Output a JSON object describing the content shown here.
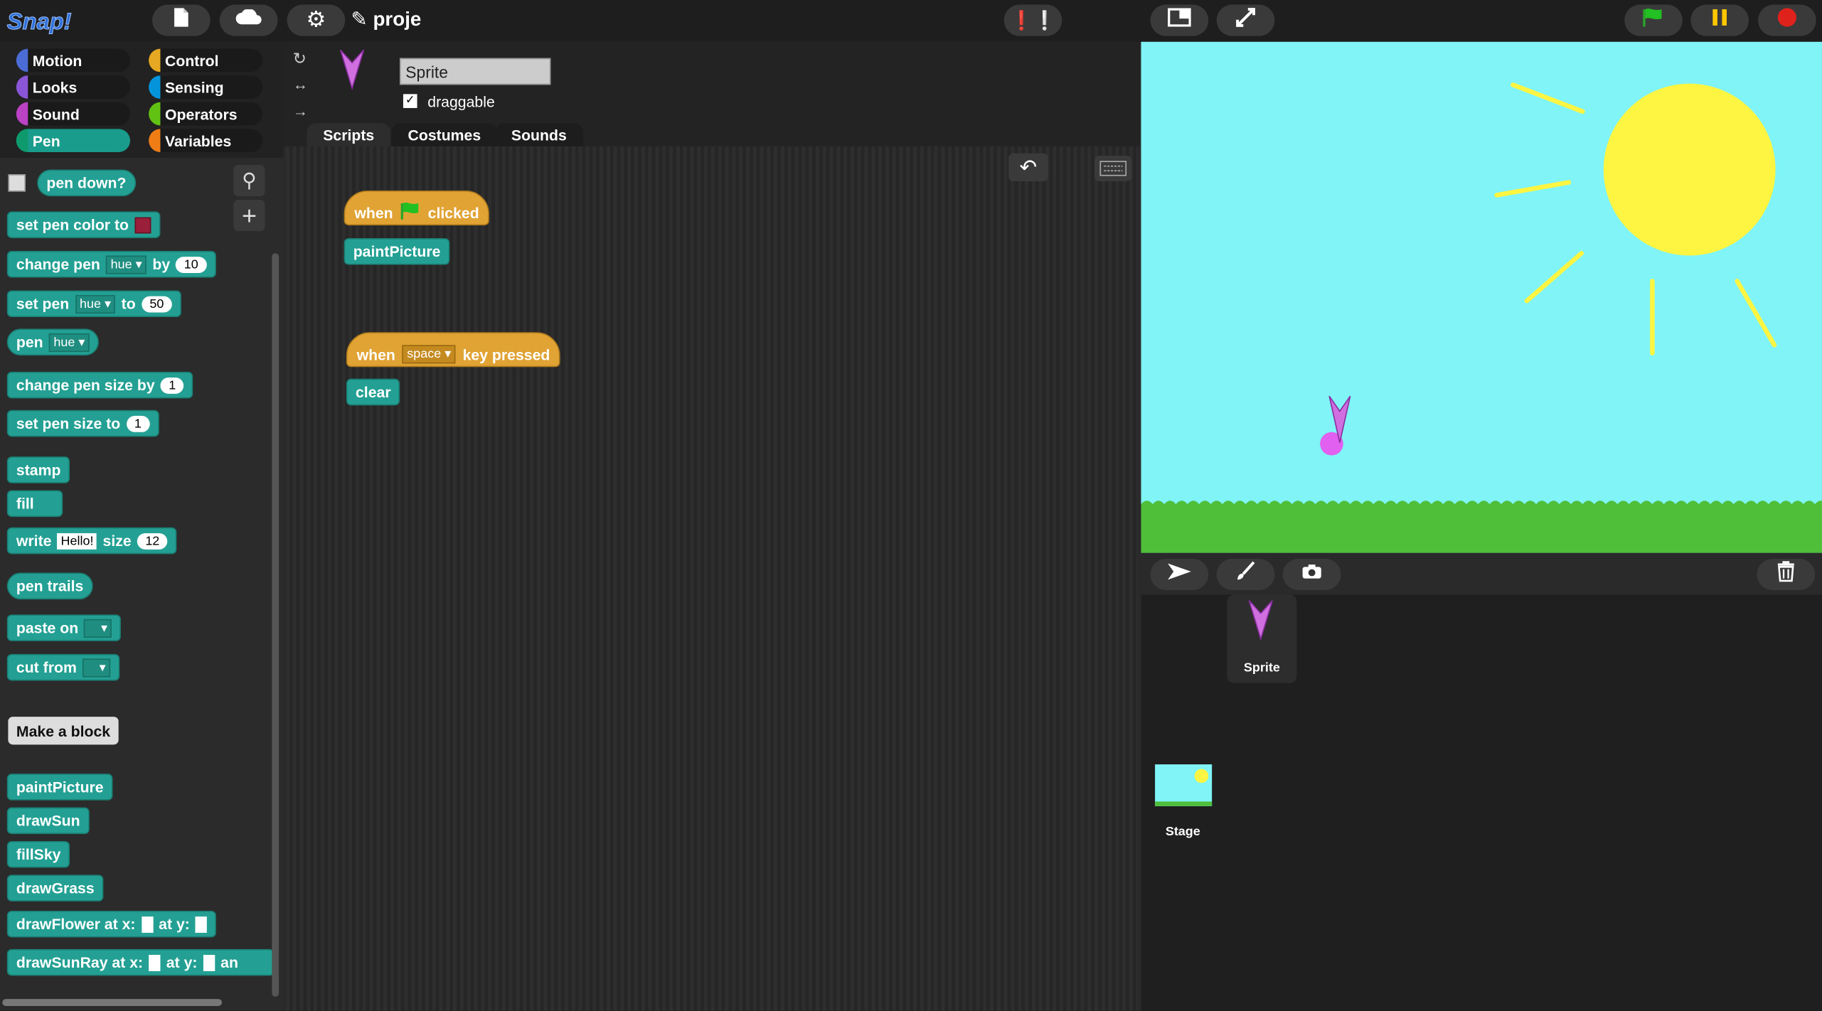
{
  "app": {
    "logo_text": "Snap!",
    "project_title": "proje"
  },
  "categories": [
    "Motion",
    "Looks",
    "Sound",
    "Pen",
    "Control",
    "Sensing",
    "Operators",
    "Variables"
  ],
  "category_colors": {
    "Motion": "#4a6cd4",
    "Looks": "#8a55d7",
    "Sound": "#bb42c3",
    "Pen": "#0e9a6c",
    "Control": "#e6a822",
    "Sensing": "#0494dc",
    "Operators": "#62c213",
    "Variables": "#ee7d16"
  },
  "palette": {
    "pen_down": "pen down?",
    "set_pen_color": "set pen color to",
    "change_pen": "change pen",
    "change_pen_by": "by",
    "change_pen_dd": "hue",
    "change_pen_val": "10",
    "set_pen": "set pen",
    "set_pen_to": "to",
    "set_pen_dd": "hue",
    "set_pen_val": "50",
    "pen": "pen",
    "pen_dd": "hue",
    "change_size": "change pen size by",
    "change_size_val": "1",
    "set_size": "set pen size to",
    "set_size_val": "1",
    "stamp": "stamp",
    "fill": "fill",
    "write": "write",
    "write_text": "Hello!",
    "write_size": "size",
    "write_size_val": "12",
    "pen_trails": "pen trails",
    "paste_on": "paste on",
    "cut_from": "cut from",
    "make_block": "Make a block",
    "custom": [
      "paintPicture",
      "drawSun",
      "fillSky",
      "drawGrass"
    ],
    "draw_flower": "drawFlower at x:",
    "draw_flower_y": "at y:",
    "draw_sunray": "drawSunRay at x:",
    "draw_sunray_y": "at y:",
    "draw_sunray_more": "an"
  },
  "sprite": {
    "name": "Sprite",
    "draggable_label": "draggable",
    "draggable_checked": true
  },
  "tabs": [
    "Scripts",
    "Costumes",
    "Sounds"
  ],
  "scripts": {
    "hat1_when": "when",
    "hat1_clicked": "clicked",
    "hat1_body": "paintPicture",
    "hat2_when": "when",
    "hat2_key": "space",
    "hat2_pressed": "key pressed",
    "hat2_body": "clear"
  },
  "corral": {
    "sprite_label": "Sprite",
    "stage_label": "Stage"
  },
  "colors": {
    "stage_sky": "#80f4f6",
    "sun": "#fdf542",
    "grass": "#4fbf3a",
    "pen_block": "#23a093",
    "control_block": "#e0a334"
  }
}
